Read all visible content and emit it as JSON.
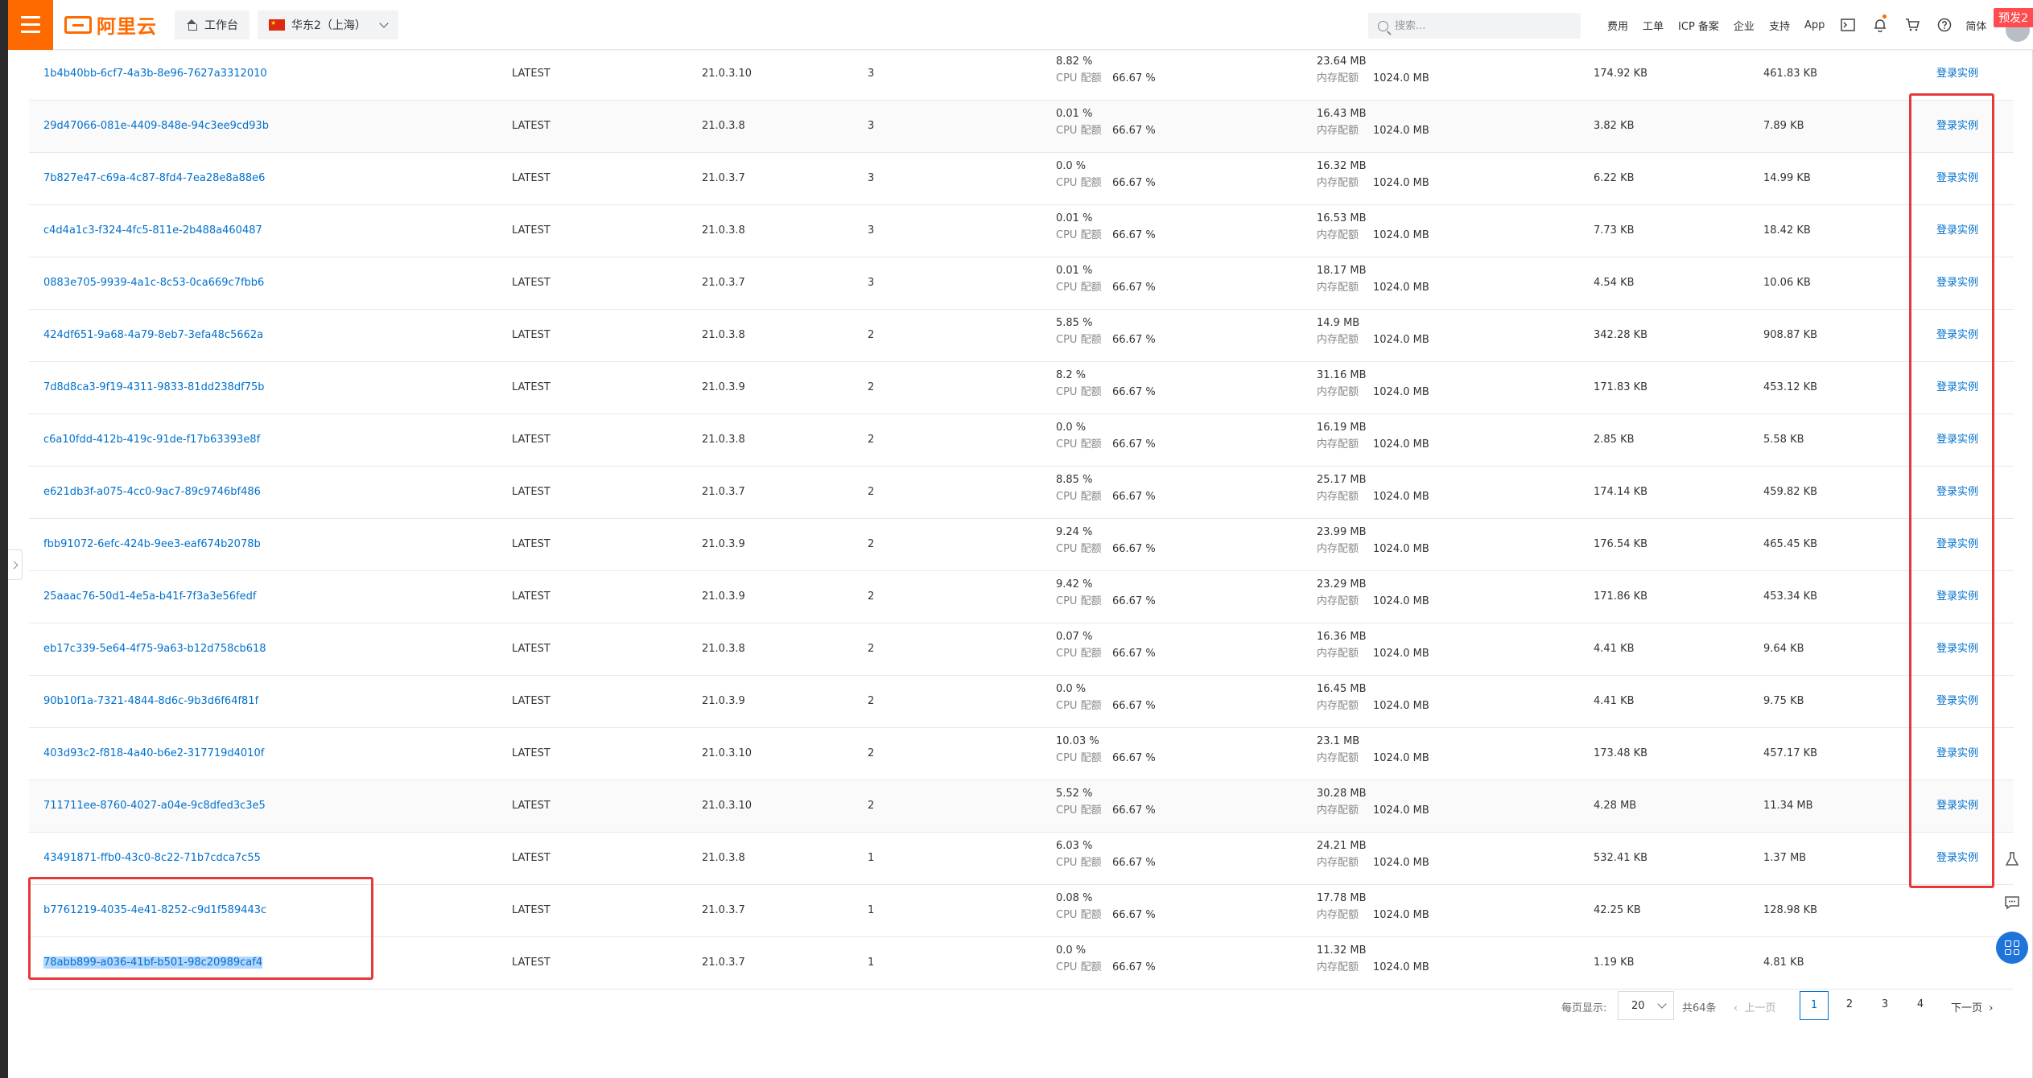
{
  "topbar": {
    "brand": "阿里云",
    "workbench": "工作台",
    "region": "华东2（上海）",
    "search_placeholder": "搜索...",
    "links": [
      "费用",
      "工单",
      "ICP 备案",
      "企业",
      "支持",
      "App"
    ],
    "lang": "简体",
    "preview_tag": "预发2"
  },
  "labels": {
    "cpu_quota": "CPU 配额",
    "mem_quota": "内存配额",
    "action": "登录实例"
  },
  "rows": [
    {
      "id": "1b4b40bb-6cf7-4a3b-8e96-7627a3312010",
      "tag": "LATEST",
      "version": "21.0.3.10",
      "count": "3",
      "cpu": "8.82 %",
      "cpu_quota": "66.67 %",
      "mem": "23.64 MB",
      "mem_quota": "1024.0 MB",
      "net_in": "174.92 KB",
      "net_out": "461.83 KB",
      "action": "登录实例"
    },
    {
      "id": "29d47066-081e-4409-848e-94c3ee9cd93b",
      "tag": "LATEST",
      "version": "21.0.3.8",
      "count": "3",
      "cpu": "0.01 %",
      "cpu_quota": "66.67 %",
      "mem": "16.43 MB",
      "mem_quota": "1024.0 MB",
      "net_in": "3.82 KB",
      "net_out": "7.89 KB",
      "action": "登录实例"
    },
    {
      "id": "7b827e47-c69a-4c87-8fd4-7ea28e8a88e6",
      "tag": "LATEST",
      "version": "21.0.3.7",
      "count": "3",
      "cpu": "0.0 %",
      "cpu_quota": "66.67 %",
      "mem": "16.32 MB",
      "mem_quota": "1024.0 MB",
      "net_in": "6.22 KB",
      "net_out": "14.99 KB",
      "action": "登录实例"
    },
    {
      "id": "c4d4a1c3-f324-4fc5-811e-2b488a460487",
      "tag": "LATEST",
      "version": "21.0.3.8",
      "count": "3",
      "cpu": "0.01 %",
      "cpu_quota": "66.67 %",
      "mem": "16.53 MB",
      "mem_quota": "1024.0 MB",
      "net_in": "7.73 KB",
      "net_out": "18.42 KB",
      "action": "登录实例"
    },
    {
      "id": "0883e705-9939-4a1c-8c53-0ca669c7fbb6",
      "tag": "LATEST",
      "version": "21.0.3.7",
      "count": "3",
      "cpu": "0.01 %",
      "cpu_quota": "66.67 %",
      "mem": "18.17 MB",
      "mem_quota": "1024.0 MB",
      "net_in": "4.54 KB",
      "net_out": "10.06 KB",
      "action": "登录实例"
    },
    {
      "id": "424df651-9a68-4a79-8eb7-3efa48c5662a",
      "tag": "LATEST",
      "version": "21.0.3.8",
      "count": "2",
      "cpu": "5.85 %",
      "cpu_quota": "66.67 %",
      "mem": "14.9 MB",
      "mem_quota": "1024.0 MB",
      "net_in": "342.28 KB",
      "net_out": "908.87 KB",
      "action": "登录实例"
    },
    {
      "id": "7d8d8ca3-9f19-4311-9833-81dd238df75b",
      "tag": "LATEST",
      "version": "21.0.3.9",
      "count": "2",
      "cpu": "8.2 %",
      "cpu_quota": "66.67 %",
      "mem": "31.16 MB",
      "mem_quota": "1024.0 MB",
      "net_in": "171.83 KB",
      "net_out": "453.12 KB",
      "action": "登录实例"
    },
    {
      "id": "c6a10fdd-412b-419c-91de-f17b63393e8f",
      "tag": "LATEST",
      "version": "21.0.3.8",
      "count": "2",
      "cpu": "0.0 %",
      "cpu_quota": "66.67 %",
      "mem": "16.19 MB",
      "mem_quota": "1024.0 MB",
      "net_in": "2.85 KB",
      "net_out": "5.58 KB",
      "action": "登录实例"
    },
    {
      "id": "e621db3f-a075-4cc0-9ac7-89c9746bf486",
      "tag": "LATEST",
      "version": "21.0.3.7",
      "count": "2",
      "cpu": "8.85 %",
      "cpu_quota": "66.67 %",
      "mem": "25.17 MB",
      "mem_quota": "1024.0 MB",
      "net_in": "174.14 KB",
      "net_out": "459.82 KB",
      "action": "登录实例"
    },
    {
      "id": "fbb91072-6efc-424b-9ee3-eaf674b2078b",
      "tag": "LATEST",
      "version": "21.0.3.9",
      "count": "2",
      "cpu": "9.24 %",
      "cpu_quota": "66.67 %",
      "mem": "23.99 MB",
      "mem_quota": "1024.0 MB",
      "net_in": "176.54 KB",
      "net_out": "465.45 KB",
      "action": "登录实例"
    },
    {
      "id": "25aaac76-50d1-4e5a-b41f-7f3a3e56fedf",
      "tag": "LATEST",
      "version": "21.0.3.9",
      "count": "2",
      "cpu": "9.42 %",
      "cpu_quota": "66.67 %",
      "mem": "23.29 MB",
      "mem_quota": "1024.0 MB",
      "net_in": "171.86 KB",
      "net_out": "453.34 KB",
      "action": "登录实例"
    },
    {
      "id": "eb17c339-5e64-4f75-9a63-b12d758cb618",
      "tag": "LATEST",
      "version": "21.0.3.8",
      "count": "2",
      "cpu": "0.07 %",
      "cpu_quota": "66.67 %",
      "mem": "16.36 MB",
      "mem_quota": "1024.0 MB",
      "net_in": "4.41 KB",
      "net_out": "9.64 KB",
      "action": "登录实例"
    },
    {
      "id": "90b10f1a-7321-4844-8d6c-9b3d6f64f81f",
      "tag": "LATEST",
      "version": "21.0.3.9",
      "count": "2",
      "cpu": "0.0 %",
      "cpu_quota": "66.67 %",
      "mem": "16.45 MB",
      "mem_quota": "1024.0 MB",
      "net_in": "4.41 KB",
      "net_out": "9.75 KB",
      "action": "登录实例"
    },
    {
      "id": "403d93c2-f818-4a40-b6e2-317719d4010f",
      "tag": "LATEST",
      "version": "21.0.3.10",
      "count": "2",
      "cpu": "10.03 %",
      "cpu_quota": "66.67 %",
      "mem": "23.1 MB",
      "mem_quota": "1024.0 MB",
      "net_in": "173.48 KB",
      "net_out": "457.17 KB",
      "action": "登录实例"
    },
    {
      "id": "711711ee-8760-4027-a04e-9c8dfed3c3e5",
      "tag": "LATEST",
      "version": "21.0.3.10",
      "count": "2",
      "cpu": "5.52 %",
      "cpu_quota": "66.67 %",
      "mem": "30.28 MB",
      "mem_quota": "1024.0 MB",
      "net_in": "4.28 MB",
      "net_out": "11.34 MB",
      "action": "登录实例"
    },
    {
      "id": "43491871-ffb0-43c0-8c22-71b7cdca7c55",
      "tag": "LATEST",
      "version": "21.0.3.8",
      "count": "1",
      "cpu": "6.03 %",
      "cpu_quota": "66.67 %",
      "mem": "24.21 MB",
      "mem_quota": "1024.0 MB",
      "net_in": "532.41 KB",
      "net_out": "1.37 MB",
      "action": "登录实例"
    },
    {
      "id": "b7761219-4035-4e41-8252-c9d1f589443c",
      "tag": "LATEST",
      "version": "21.0.3.7",
      "count": "1",
      "cpu": "0.08 %",
      "cpu_quota": "66.67 %",
      "mem": "17.78 MB",
      "mem_quota": "1024.0 MB",
      "net_in": "42.25 KB",
      "net_out": "128.98 KB",
      "action": ""
    },
    {
      "id": "78abb899-a036-41bf-b501-98c20989caf4",
      "tag": "LATEST",
      "version": "21.0.3.7",
      "count": "1",
      "cpu": "0.0 %",
      "cpu_quota": "66.67 %",
      "mem": "11.32 MB",
      "mem_quota": "1024.0 MB",
      "net_in": "1.19 KB",
      "net_out": "4.81 KB",
      "action": ""
    }
  ],
  "pagination": {
    "per_page_label": "每页显示:",
    "per_page": "20",
    "total": "共64条",
    "prev": "上一页",
    "pages": [
      "1",
      "2",
      "3",
      "4"
    ],
    "current": "1",
    "next": "下一页"
  },
  "colors": {
    "brand": "#ff6a00",
    "link": "#0070cc",
    "highlight": "#e4393c"
  }
}
